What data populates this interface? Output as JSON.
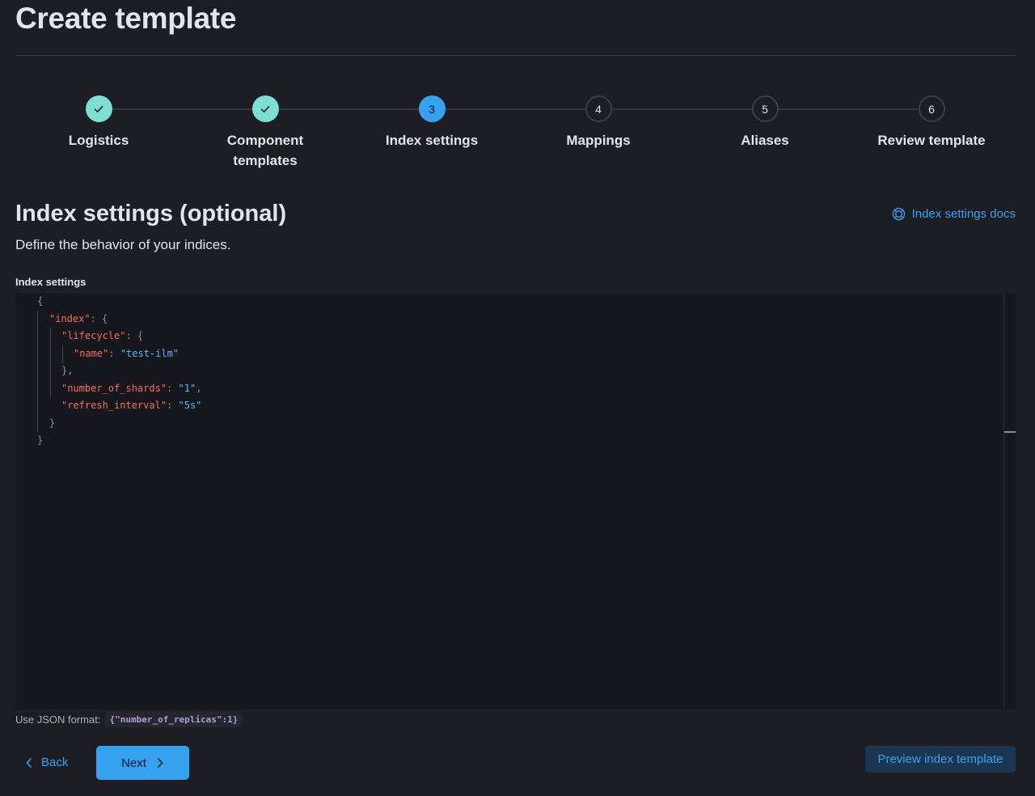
{
  "page": {
    "title": "Create template"
  },
  "steps": [
    {
      "number": "1",
      "label": "Logistics",
      "status": "complete"
    },
    {
      "number": "2",
      "label": "Component templates",
      "status": "complete"
    },
    {
      "number": "3",
      "label": "Index settings",
      "status": "current"
    },
    {
      "number": "4",
      "label": "Mappings",
      "status": "todo"
    },
    {
      "number": "5",
      "label": "Aliases",
      "status": "todo"
    },
    {
      "number": "6",
      "label": "Review template",
      "status": "todo"
    }
  ],
  "section": {
    "title": "Index settings (optional)",
    "description": "Define the behavior of your indices.",
    "docs_link": "Index settings docs"
  },
  "editor": {
    "label": "Index settings",
    "code": {
      "index_key": "\"index\"",
      "lifecycle_key": "\"lifecycle\"",
      "name_key": "\"name\"",
      "name_value": "\"test-ilm\"",
      "shards_key": "\"number_of_shards\"",
      "shards_value": "\"1\"",
      "refresh_key": "\"refresh_interval\"",
      "refresh_value": "\"5s\""
    },
    "help_prefix": "Use JSON format:",
    "help_example": "{\"number_of_replicas\":1}"
  },
  "actions": {
    "back_label": "Back",
    "next_label": "Next",
    "preview_label": "Preview index template"
  },
  "colors": {
    "background": "#1d1e24",
    "primary": "#36a2ef",
    "success": "#7ddfd4",
    "code_key": "#f66c5c",
    "code_string": "#5cb1ff"
  }
}
